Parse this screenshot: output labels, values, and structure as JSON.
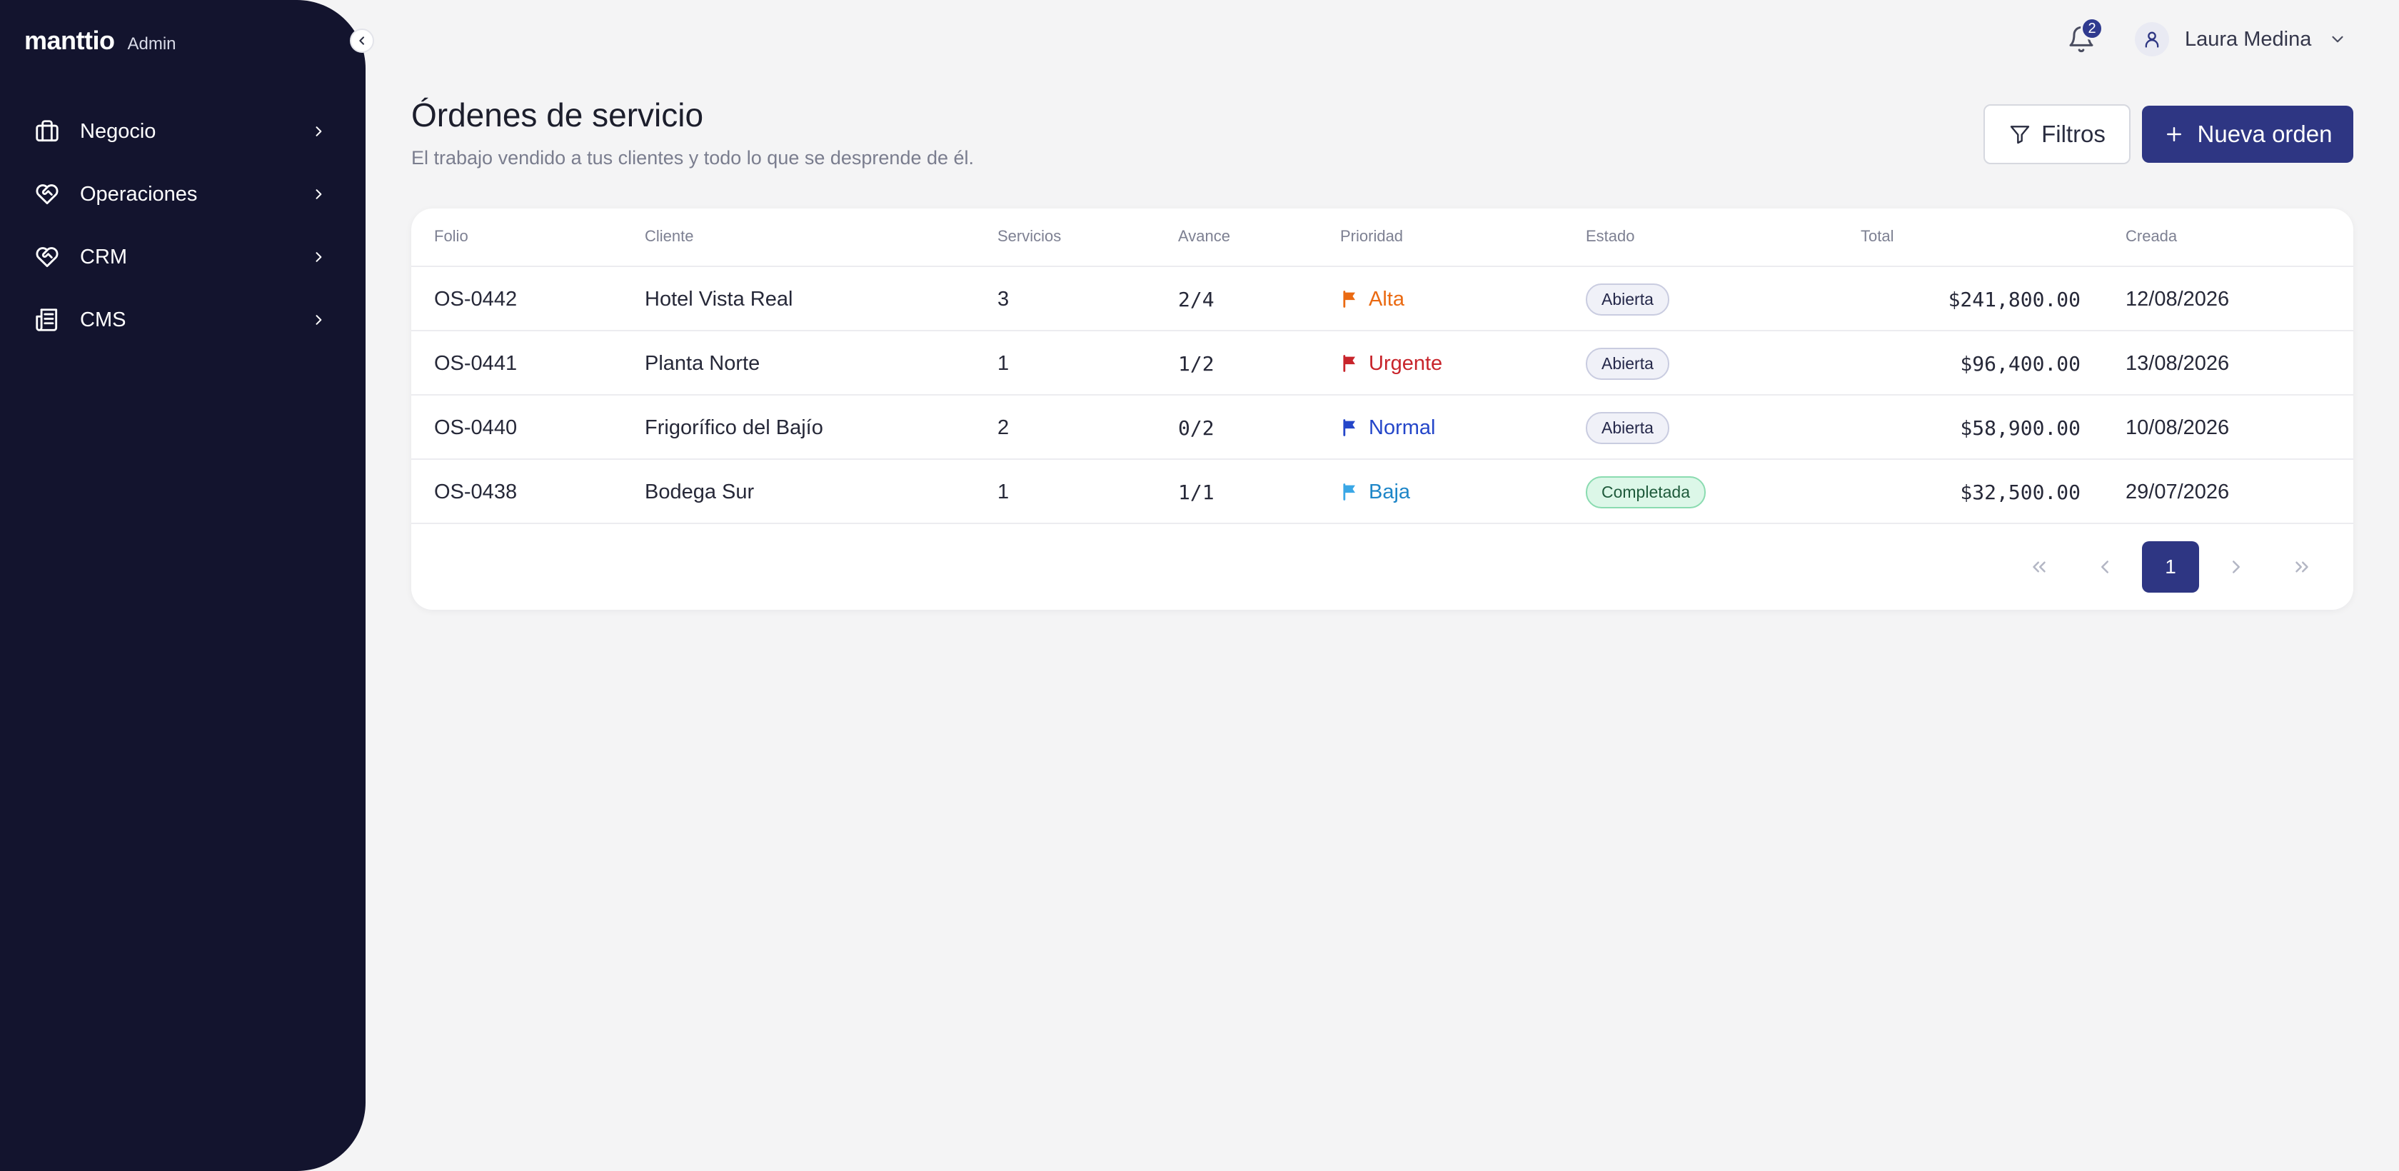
{
  "sidebar": {
    "brand": "manttio",
    "brand_tag": "Admin",
    "items": [
      {
        "label": "Negocio",
        "icon": "briefcase-icon"
      },
      {
        "label": "Operaciones",
        "icon": "heart-handshake-icon"
      },
      {
        "label": "CRM",
        "icon": "heart-handshake-icon"
      },
      {
        "label": "CMS",
        "icon": "newspaper-icon"
      }
    ]
  },
  "topbar": {
    "notifications_count": "2",
    "user_name": "Laura Medina"
  },
  "header": {
    "title": "Órdenes de servicio",
    "subtitle": "El trabajo vendido a tus clientes y todo lo que se desprende de él.",
    "filters_label": "Filtros",
    "new_label": "Nueva orden"
  },
  "table": {
    "columns": [
      "Folio",
      "Cliente",
      "Servicios",
      "Avance",
      "Prioridad",
      "Estado",
      "Total",
      "Creada"
    ],
    "rows": [
      {
        "folio": "OS-0442",
        "cliente": "Hotel Vista Real",
        "servicios": "3",
        "avance": "2/4",
        "prioridad": "Alta",
        "estado": "Abierta",
        "total": "$241,800.00",
        "creada": "12/08/2026"
      },
      {
        "folio": "OS-0441",
        "cliente": "Planta Norte",
        "servicios": "1",
        "avance": "1/2",
        "prioridad": "Urgente",
        "estado": "Abierta",
        "total": "$96,400.00",
        "creada": "13/08/2026"
      },
      {
        "folio": "OS-0440",
        "cliente": "Frigorífico del Bajío",
        "servicios": "2",
        "avance": "0/2",
        "prioridad": "Normal",
        "estado": "Abierta",
        "total": "$58,900.00",
        "creada": "10/08/2026"
      },
      {
        "folio": "OS-0438",
        "cliente": "Bodega Sur",
        "servicios": "1",
        "avance": "1/1",
        "prioridad": "Baja",
        "estado": "Completada",
        "total": "$32,500.00",
        "creada": "29/07/2026"
      }
    ]
  },
  "priority_colors": {
    "Alta": "#ea6a12",
    "Urgente": "#c8242b",
    "Normal": "#2446c9",
    "Baja": "#3aa7e6"
  },
  "pagination": {
    "current_page": "1"
  }
}
